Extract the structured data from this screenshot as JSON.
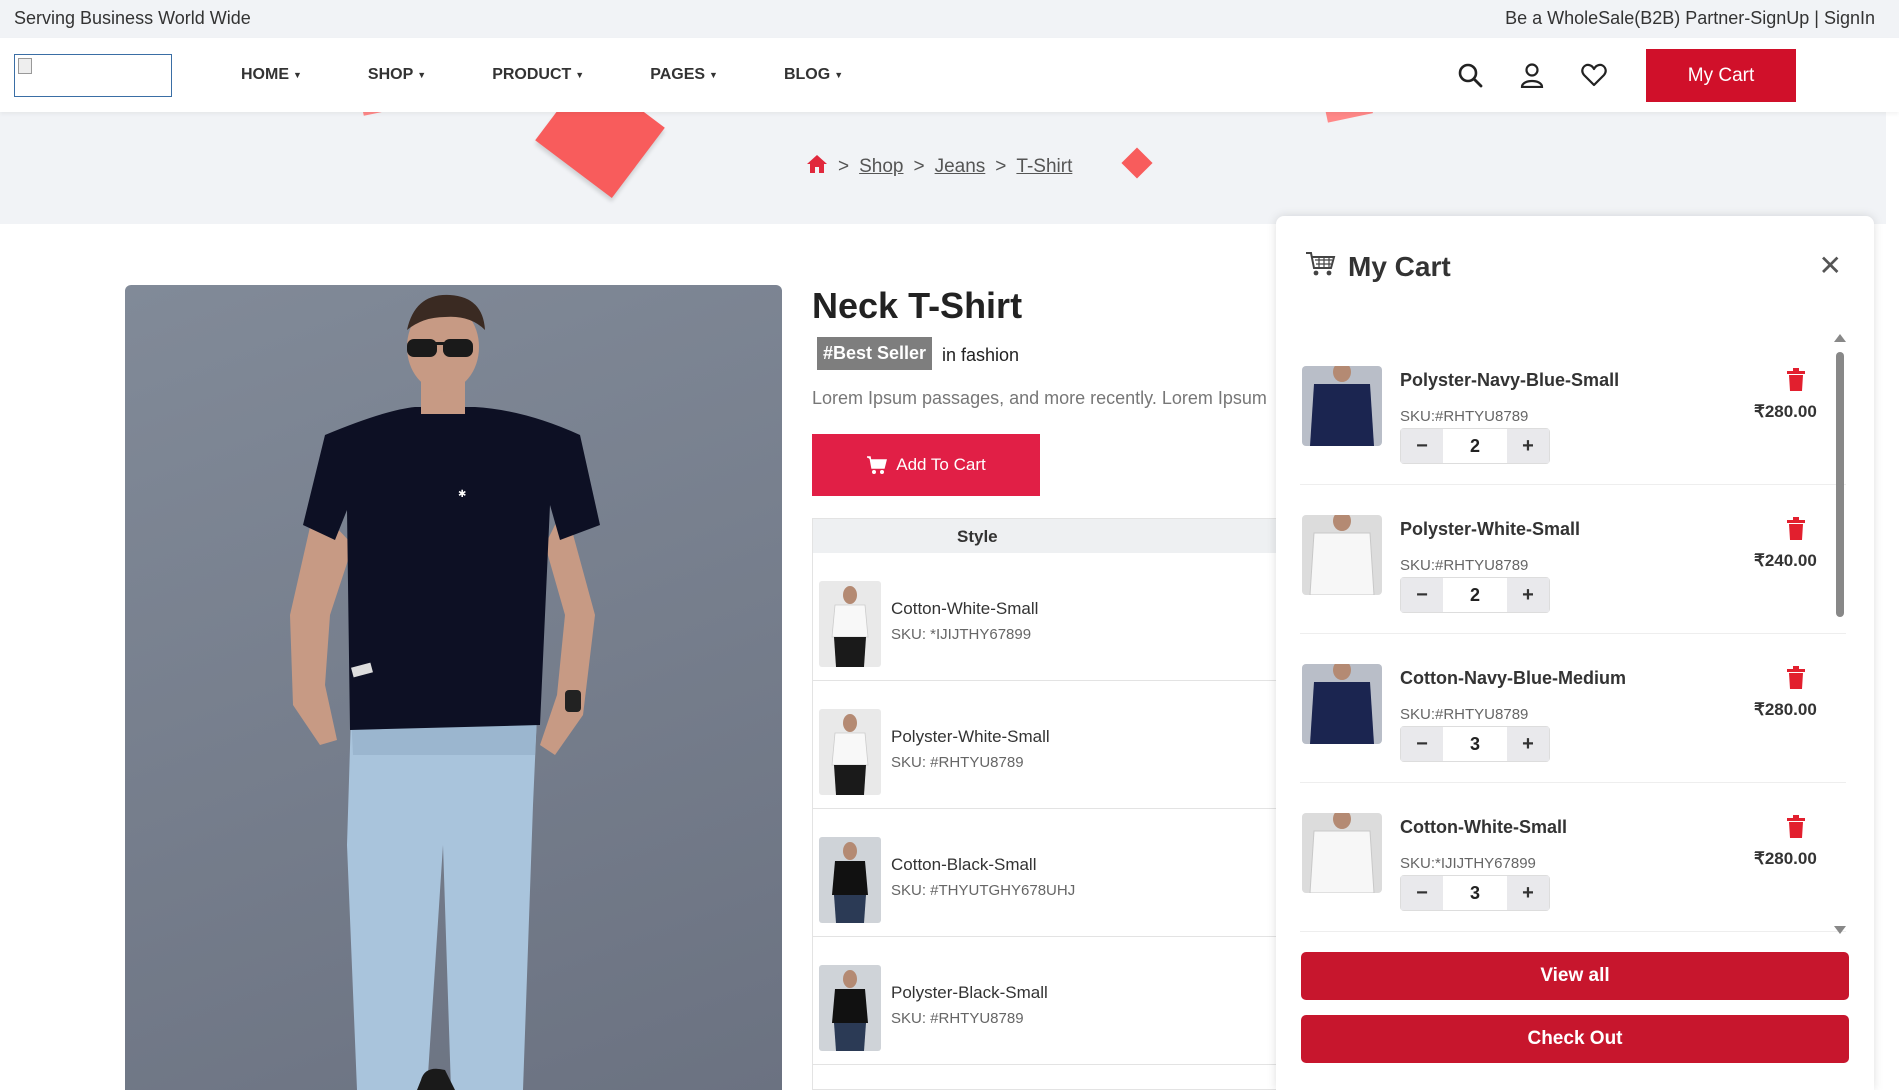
{
  "topbar": {
    "tagline": "Serving Business World Wide",
    "partner_link": "Be a WholeSale(B2B) Partner-SignUp | SignIn"
  },
  "nav": {
    "menu": [
      {
        "label": "HOME"
      },
      {
        "label": "SHOP"
      },
      {
        "label": "PRODUCT"
      },
      {
        "label": "PAGES"
      },
      {
        "label": "BLOG"
      }
    ],
    "icons": [
      "search-icon",
      "user-icon",
      "heart-icon"
    ],
    "cart_button": "My Cart"
  },
  "breadcrumb": {
    "home_icon": "home-icon",
    "items": [
      "Shop",
      "Jeans",
      "T-Shirt"
    ],
    "separator": ">"
  },
  "product": {
    "title": "Neck T-Shirt",
    "badge": "#Best Seller",
    "badge_suffix": "in fashion",
    "description": "Lorem Ipsum passages, and more recently. Lorem Ipsum",
    "add_to_cart": "Add To Cart",
    "style_header": "Style",
    "styles": [
      {
        "name": "Cotton-White-Small",
        "sku": "SKU: *IJIJTHY67899",
        "shirt": "white"
      },
      {
        "name": "Polyster-White-Small",
        "sku": "SKU: #RHTYU8789",
        "shirt": "white"
      },
      {
        "name": "Cotton-Black-Small",
        "sku": "SKU: #THYUTGHY678UHJ",
        "shirt": "black"
      },
      {
        "name": "Polyster-Black-Small",
        "sku": "SKU: #RHTYU8789",
        "shirt": "black"
      }
    ]
  },
  "cart": {
    "title": "My Cart",
    "close": "✕",
    "items": [
      {
        "name": "Polyster-Navy-Blue-Small",
        "sku": "SKU:#RHTYU8789",
        "qty": "2",
        "price": "₹280.00",
        "shirt": "navy"
      },
      {
        "name": "Polyster-White-Small",
        "sku": "SKU:#RHTYU8789",
        "qty": "2",
        "price": "₹240.00",
        "shirt": "white"
      },
      {
        "name": "Cotton-Navy-Blue-Medium",
        "sku": "SKU:#RHTYU8789",
        "qty": "3",
        "price": "₹280.00",
        "shirt": "navy"
      },
      {
        "name": "Cotton-White-Small",
        "sku": "SKU:*IJIJTHY67899",
        "qty": "3",
        "price": "₹280.00",
        "shirt": "white"
      }
    ],
    "minus": "−",
    "plus": "+",
    "view_all": "View all",
    "checkout": "Check Out"
  },
  "colors": {
    "accent": "#d0102a",
    "add_to_cart": "#e11f46",
    "cart_buttons": "#c7162d",
    "hero_bg": "#f1f3f6",
    "decor": "#f85c5c"
  }
}
